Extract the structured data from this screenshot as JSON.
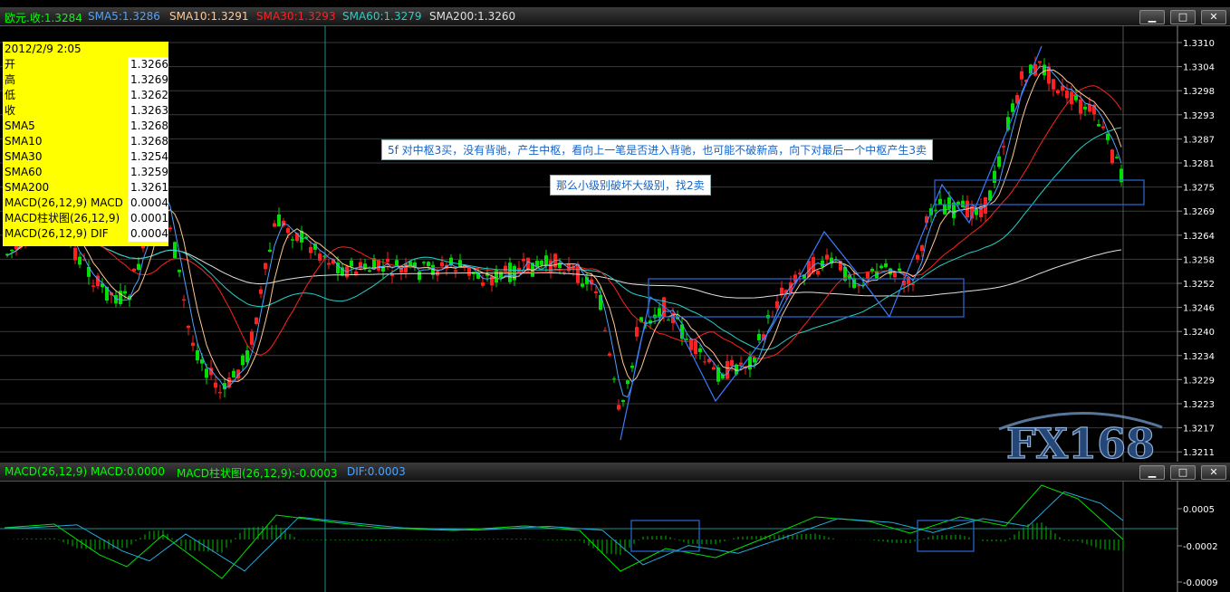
{
  "main_panel": {
    "title_items": [
      {
        "text": "欧元.收:1.3284",
        "color": "#00ff00"
      },
      {
        "text": "SMA5:1.3286",
        "color": "#4da3ff"
      },
      {
        "text": "SMA10:1.3291",
        "color": "#ffc896"
      },
      {
        "text": "SMA30:1.3293",
        "color": "#ff2020"
      },
      {
        "text": "SMA60:1.3279",
        "color": "#26d0c8"
      },
      {
        "text": "SMA200:1.3260",
        "color": "#e0e0e0"
      }
    ],
    "window_buttons": {
      "minimize": "▁",
      "maximize": "□",
      "close": "✕"
    },
    "price_scale": [
      "1.3310",
      "1.3304",
      "1.3298",
      "1.3293",
      "1.3287",
      "1.3281",
      "1.3275",
      "1.3269",
      "1.3264",
      "1.3258",
      "1.3252",
      "1.3246",
      "1.3240",
      "1.3234",
      "1.3229",
      "1.3223",
      "1.3217",
      "1.3211"
    ]
  },
  "info_box": {
    "date": "2012/2/9 2:05",
    "rows": [
      {
        "label": "开",
        "value": "1.3266"
      },
      {
        "label": "高",
        "value": "1.3269"
      },
      {
        "label": "低",
        "value": "1.3262"
      },
      {
        "label": "收",
        "value": "1.3263"
      },
      {
        "label": "SMA5",
        "value": "1.3268"
      },
      {
        "label": "SMA10",
        "value": "1.3268"
      },
      {
        "label": "SMA30",
        "value": "1.3254"
      },
      {
        "label": "SMA60",
        "value": "1.3259"
      },
      {
        "label": "SMA200",
        "value": "1.3261"
      },
      {
        "label": "MACD(26,12,9) MACD",
        "value": "0.0004"
      },
      {
        "label": "MACD柱状图(26,12,9)",
        "value": "0.0001"
      },
      {
        "label": "MACD(26,12,9) DIF",
        "value": "0.0004"
      }
    ]
  },
  "annotations": {
    "note1": "5f 对中枢3买，没有背驰，产生中枢，看向上一笔是否进入背驰，也可能不破新高，向下对最后一个中枢产生3卖",
    "note2": "那么小级别破坏大级别，找2卖"
  },
  "watermark": "FX168",
  "macd_panel": {
    "title_items": [
      {
        "text": "MACD(26,12,9) MACD:0.0000",
        "color": "#00ff00"
      },
      {
        "text": "MACD柱状图(26,12,9):-0.0003",
        "color": "#00ff00"
      },
      {
        "text": "DIF:0.0003",
        "color": "#4da3ff"
      }
    ],
    "scale": [
      "0.0005",
      "-0.0002",
      "-0.0009"
    ]
  },
  "colors": {
    "up": "#ff2020",
    "down": "#00e000",
    "sma5": "#4da3ff",
    "sma10": "#ffc896",
    "sma30": "#ff2020",
    "sma60": "#26d0c8",
    "sma200": "#e0e0e0",
    "box": "#2a6ad8",
    "grid": "#3a3a3a"
  }
}
